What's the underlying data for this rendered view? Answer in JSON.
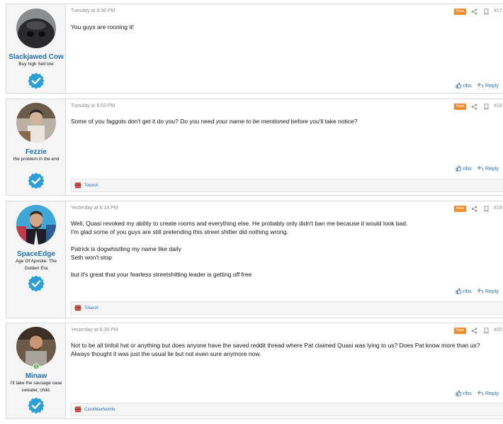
{
  "posts": [
    {
      "author": "Slackjawed Cow",
      "title": "Buy high Sell low",
      "time": "Tuesday at 8:36 PM",
      "new_label": "New",
      "number": "#17",
      "paragraphs": [
        "You guys are rooning it!"
      ],
      "actions": {
        "ribs": "ribs",
        "reply": "Reply"
      }
    },
    {
      "author": "Fezzie",
      "title": "the problem in the end",
      "time": "Tuesday at 8:53 PM",
      "new_label": "New",
      "number": "#18",
      "text_before": "Some of you faggots don't get it do you? Do you need ",
      "text_em": "your name to be mentioned",
      "text_after": " before you'll take notice?",
      "actions": {
        "ribs": "ribs",
        "reply": "Reply"
      },
      "signature": "TokenX"
    },
    {
      "author": "SpaceEdge",
      "title": "Age Of Apostle: The Golden Era",
      "time": "Yesterday at 6:14 PM",
      "new_label": "New",
      "number": "#19",
      "paragraphs": [
        "Well, Quasi revoked my ability to create rooms and everything else. He probably only didn't ban me because it would look bad.",
        "I'm glad some of you guys are still pretending this street shitter did nothing wrong.",
        "",
        "Patrick is dogwhistling my name like daily",
        "Seth won't stop",
        "",
        "but it's great that your fearless streetshitting leader is getting off free"
      ],
      "actions": {
        "ribs": "ribs",
        "reply": "Reply"
      },
      "signature": "TokenX"
    },
    {
      "author": "Minaw",
      "title": "I'll take the sausage case sweater, child.",
      "time": "Yesterday at 6:39 PM",
      "new_label": "New",
      "number": "#20",
      "paragraphs": [
        "Not to be all tinfoil hat or anything but does anyone have the saved reddit thread where Pat claimed Quasi was lying to us? Does Pat know more than us?",
        "Always thought it was just the usual lie but not even sure anymore now."
      ],
      "actions": {
        "ribs": "ribs",
        "reply": "Reply"
      },
      "signature": "CarolMaxheimle"
    }
  ],
  "colors": {
    "username": "#1f6fb2",
    "new_badge": "#f08c2c",
    "verified": "#2a9fd8",
    "link": "#2b6ebd"
  }
}
